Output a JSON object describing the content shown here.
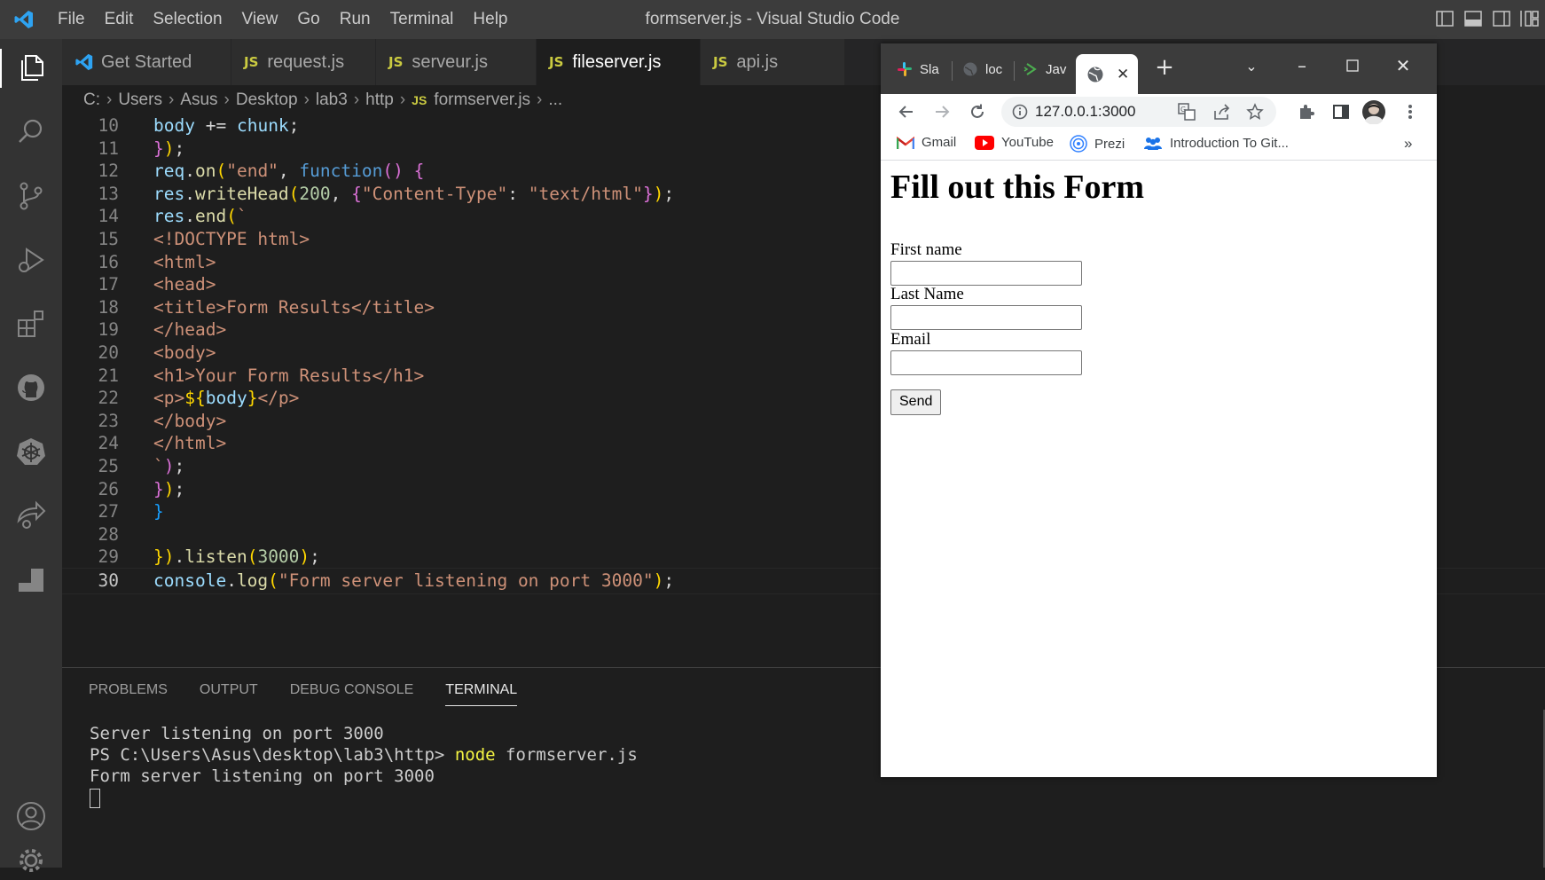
{
  "window": {
    "title": "formserver.js - Visual Studio Code"
  },
  "menu": [
    "File",
    "Edit",
    "Selection",
    "View",
    "Go",
    "Run",
    "Terminal",
    "Help"
  ],
  "tabs": [
    {
      "label": "Get Started",
      "icon": "vscode-icon"
    },
    {
      "label": "request.js",
      "badge": "JS"
    },
    {
      "label": "serveur.js",
      "badge": "JS"
    },
    {
      "label": "fileserver.js",
      "badge": "JS"
    },
    {
      "label": "api.js",
      "badge": "JS"
    }
  ],
  "breadcrumb": [
    "C:",
    "Users",
    "Asus",
    "Desktop",
    "lab3",
    "http",
    "formserver.js",
    "..."
  ],
  "breadcrumb_badge": "JS",
  "code_lines": [
    {
      "n": "10",
      "text": "body += chunk;"
    },
    {
      "n": "11",
      "text": "});"
    },
    {
      "n": "12",
      "text": "req.on(\"end\", function() {"
    },
    {
      "n": "13",
      "text": "res.writeHead(200, {\"Content-Type\": \"text/html\"});"
    },
    {
      "n": "14",
      "text": "res.end(`"
    },
    {
      "n": "15",
      "text": "<!DOCTYPE html>"
    },
    {
      "n": "16",
      "text": "<html>"
    },
    {
      "n": "17",
      "text": "<head>"
    },
    {
      "n": "18",
      "text": "<title>Form Results</title>"
    },
    {
      "n": "19",
      "text": "</head>"
    },
    {
      "n": "20",
      "text": "<body>"
    },
    {
      "n": "21",
      "text": "<h1>Your Form Results</h1>"
    },
    {
      "n": "22",
      "text": "<p>${body}</p>"
    },
    {
      "n": "23",
      "text": "</body>"
    },
    {
      "n": "24",
      "text": "</html>"
    },
    {
      "n": "25",
      "text": "`);"
    },
    {
      "n": "26",
      "text": "});"
    },
    {
      "n": "27",
      "text": "}"
    },
    {
      "n": "28",
      "text": ""
    },
    {
      "n": "29",
      "text": "}).listen(3000);"
    },
    {
      "n": "30",
      "text": "console.log(\"Form server listening on port 3000\");"
    }
  ],
  "panel": {
    "tabs": [
      "PROBLEMS",
      "OUTPUT",
      "DEBUG CONSOLE",
      "TERMINAL"
    ],
    "active_tab": "TERMINAL",
    "terminal": {
      "line1": "Server listening on port 3000",
      "prompt": "PS C:\\Users\\Asus\\desktop\\lab3\\http>",
      "command": "node",
      "args": "formserver.js",
      "line3": "Form server listening on port 3000"
    }
  },
  "browser": {
    "tabs": [
      {
        "label": "Sla",
        "icon": "slack-icon"
      },
      {
        "label": "loc",
        "icon": "globe-icon"
      },
      {
        "label": "Jav",
        "icon": "play-icon"
      },
      {
        "label": "",
        "icon": "globe-icon",
        "active": true
      }
    ],
    "url": "127.0.0.1:3000",
    "bookmarks": [
      {
        "label": "Gmail",
        "icon": "gmail-icon"
      },
      {
        "label": "YouTube",
        "icon": "youtube-icon"
      },
      {
        "label": "Prezi",
        "icon": "prezi-icon"
      },
      {
        "label": "Introduction To Git...",
        "icon": "people-icon"
      }
    ],
    "bookmarks_more": "»",
    "page": {
      "heading": "Fill out this Form",
      "fields": [
        {
          "label": "First name",
          "value": ""
        },
        {
          "label": "Last Name",
          "value": ""
        },
        {
          "label": "Email",
          "value": ""
        }
      ],
      "submit": "Send"
    }
  },
  "colors": {
    "editor_bg": "#1e1e1e",
    "titlebar_bg": "#3c3c3c",
    "activitybar_bg": "#333333",
    "js_badge": "#cbcb41",
    "accent_blue": "#0078d4"
  }
}
